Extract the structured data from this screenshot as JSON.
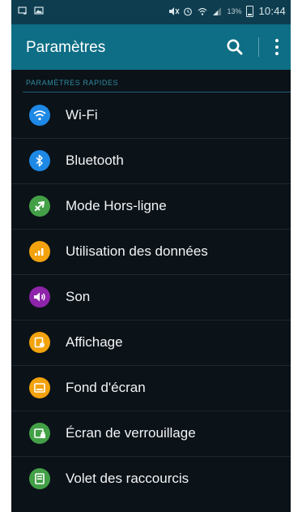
{
  "status_bar": {
    "battery_percent": "13%",
    "time": "10:44"
  },
  "app_bar": {
    "title": "Paramètres"
  },
  "section": {
    "header": "PARAMÈTRES RAPIDES"
  },
  "items": [
    {
      "label": "Wi-Fi",
      "icon": "wifi-icon",
      "color": "#1e88e5"
    },
    {
      "label": "Bluetooth",
      "icon": "bluetooth-icon",
      "color": "#1e88e5"
    },
    {
      "label": "Mode Hors-ligne",
      "icon": "airplane-icon",
      "color": "#43a047"
    },
    {
      "label": "Utilisation des données",
      "icon": "data-usage-icon",
      "color": "#f2a20d"
    },
    {
      "label": "Son",
      "icon": "speaker-icon",
      "color": "#8e24aa"
    },
    {
      "label": "Affichage",
      "icon": "display-icon",
      "color": "#f2a20d"
    },
    {
      "label": "Fond d'écran",
      "icon": "wallpaper-icon",
      "color": "#f2a20d"
    },
    {
      "label": "Écran de verrouillage",
      "icon": "lock-screen-icon",
      "color": "#43a047"
    },
    {
      "label": "Volet des raccourcis",
      "icon": "notification-panel-icon",
      "color": "#43a047"
    }
  ]
}
